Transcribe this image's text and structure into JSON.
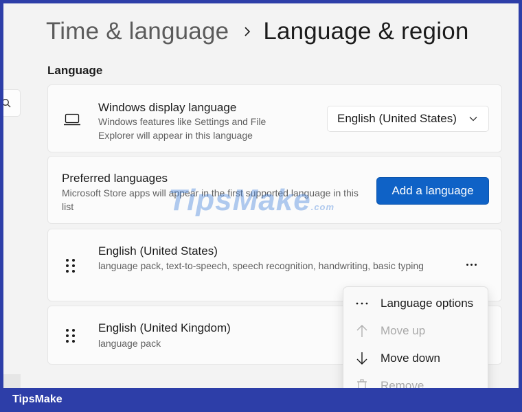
{
  "breadcrumb": {
    "parent": "Time & language",
    "current": "Language & region"
  },
  "section_title": "Language",
  "display_language": {
    "title": "Windows display language",
    "description": "Windows features like Settings and File Explorer will appear in this language",
    "selected": "English (United States)"
  },
  "preferred": {
    "title": "Preferred languages",
    "description": "Microsoft Store apps will appear in the first supported language in this list",
    "add_button": "Add a language"
  },
  "languages": [
    {
      "name": "English (United States)",
      "features": "language pack, text-to-speech, speech recognition, handwriting, basic typing"
    },
    {
      "name": "English (United Kingdom)",
      "features": "language pack"
    }
  ],
  "context_menu": [
    {
      "label": "Language options",
      "icon": "more-horizontal-icon",
      "enabled": true
    },
    {
      "label": "Move up",
      "icon": "arrow-up-icon",
      "enabled": false
    },
    {
      "label": "Move down",
      "icon": "arrow-down-icon",
      "enabled": true
    },
    {
      "label": "Remove",
      "icon": "trash-icon",
      "enabled": false
    }
  ],
  "watermark": {
    "text": "TipsMake",
    "suffix": ".com"
  },
  "brand": "TipsMake",
  "colors": {
    "accent": "#0f62c6",
    "frame_background": "#2d3ea8",
    "page_background": "#f3f3f3"
  }
}
